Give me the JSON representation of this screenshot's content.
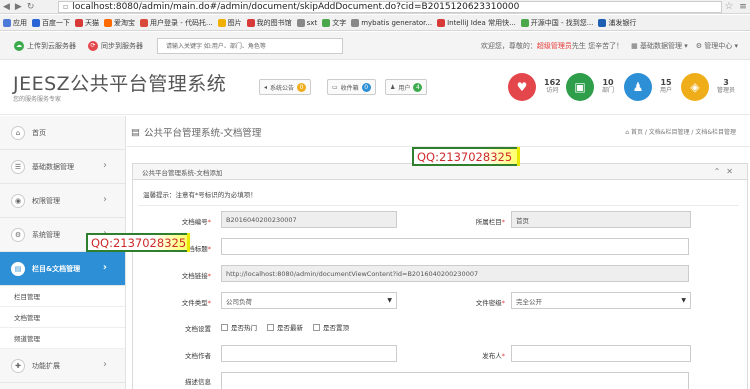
{
  "browser": {
    "url": "localhost:8080/admin/main.do#/admin/document/skipAddDocument.do?cid=B2015120623310000",
    "bookmarks": [
      {
        "label": "应用",
        "color": "#4a79d8"
      },
      {
        "label": "百度一下",
        "color": "#2a63d6"
      },
      {
        "label": "天猫",
        "color": "#d83a3a"
      },
      {
        "label": "爱淘宝",
        "color": "#ff6a00"
      },
      {
        "label": "用户登录 - 代码托...",
        "color": "#d84a3a"
      },
      {
        "label": "图片",
        "color": "#f0b000"
      },
      {
        "label": "我的图书馆",
        "color": "#d83a3a"
      },
      {
        "label": "sxt",
        "color": "#888888"
      },
      {
        "label": "文字",
        "color": "#4aa84a"
      },
      {
        "label": "mybatis generator...",
        "color": "#888888"
      },
      {
        "label": "IntelliJ Idea 常用快...",
        "color": "#d83a3a"
      },
      {
        "label": "开源中国 - 找到您...",
        "color": "#4aa84a"
      },
      {
        "label": "浦发银行",
        "color": "#1f5fb3"
      }
    ]
  },
  "topbar": {
    "btn_site": "上传到云服务器",
    "btn_sync": "同步到服务器",
    "search_placeholder": "请输入关键字 如:用户、部门、角色等",
    "welcome_prefix": "欢迎您，尊敬的：",
    "role": "超级管理员",
    "welcome_suffix": "先生 您辛苦了！",
    "base_data": "基础数据管理",
    "admin_center": "管理中心"
  },
  "header": {
    "brand": "JEESZ公共平台管理系统",
    "slogan": "您的服务服务专家",
    "btn_notice": "系统公告",
    "badge_notice": "0",
    "btn_mail": "收件箱",
    "badge_mail": "0",
    "btn_user": "用户",
    "badge_user": "4",
    "stats": [
      {
        "value": "162",
        "label": "访问",
        "color": "#e4474b",
        "icon": "heart-icon"
      },
      {
        "value": "10",
        "label": "部门",
        "color": "#2f9e4a",
        "icon": "money-icon"
      },
      {
        "value": "15",
        "label": "用户",
        "color": "#2d8fd5",
        "icon": "user-icon"
      },
      {
        "value": "3",
        "label": "管理员",
        "color": "#f0ad1a",
        "icon": "dropbox-icon"
      }
    ]
  },
  "sidebar": {
    "items": [
      {
        "label": "首页"
      },
      {
        "label": "基础数据管理"
      },
      {
        "label": "权限管理"
      },
      {
        "label": "系统管理"
      },
      {
        "label": "栏目&文档管理"
      }
    ],
    "subitems": [
      "栏目管理",
      "文档管理",
      "频道管理"
    ],
    "last_item": "功能扩展"
  },
  "content": {
    "page_title": "公共平台管理系统-文档管理",
    "breadcrumb": "首页 / 文档&栏目管理 / 文档&栏目管理",
    "panel_title": "公共平台管理系统-文档添加",
    "tip": "温馨提示：注意有*号标识的为必填项！",
    "fields": {
      "doc_no_label": "文档编号",
      "doc_no_value": "B2016040200230007",
      "column_label": "所属栏目",
      "column_value": "首页",
      "doc_title_label": "文档标题",
      "doc_link_label": "文档链接",
      "doc_link_value": "http://localhost:8080/admin/documentViewContent?id=B2016040200230007",
      "doc_type_label": "文件类型",
      "doc_type_value": "公司负荷",
      "secret_label": "文件密级",
      "secret_value": "完全公开",
      "settings_label": "文档设置",
      "chk_hot": "是否热门",
      "chk_new": "是否最新",
      "chk_top": "是否置顶",
      "author_label": "文档作者",
      "publisher_label": "发布人",
      "desc_label": "描述信息"
    }
  },
  "watermark": "QQ:2137028325"
}
